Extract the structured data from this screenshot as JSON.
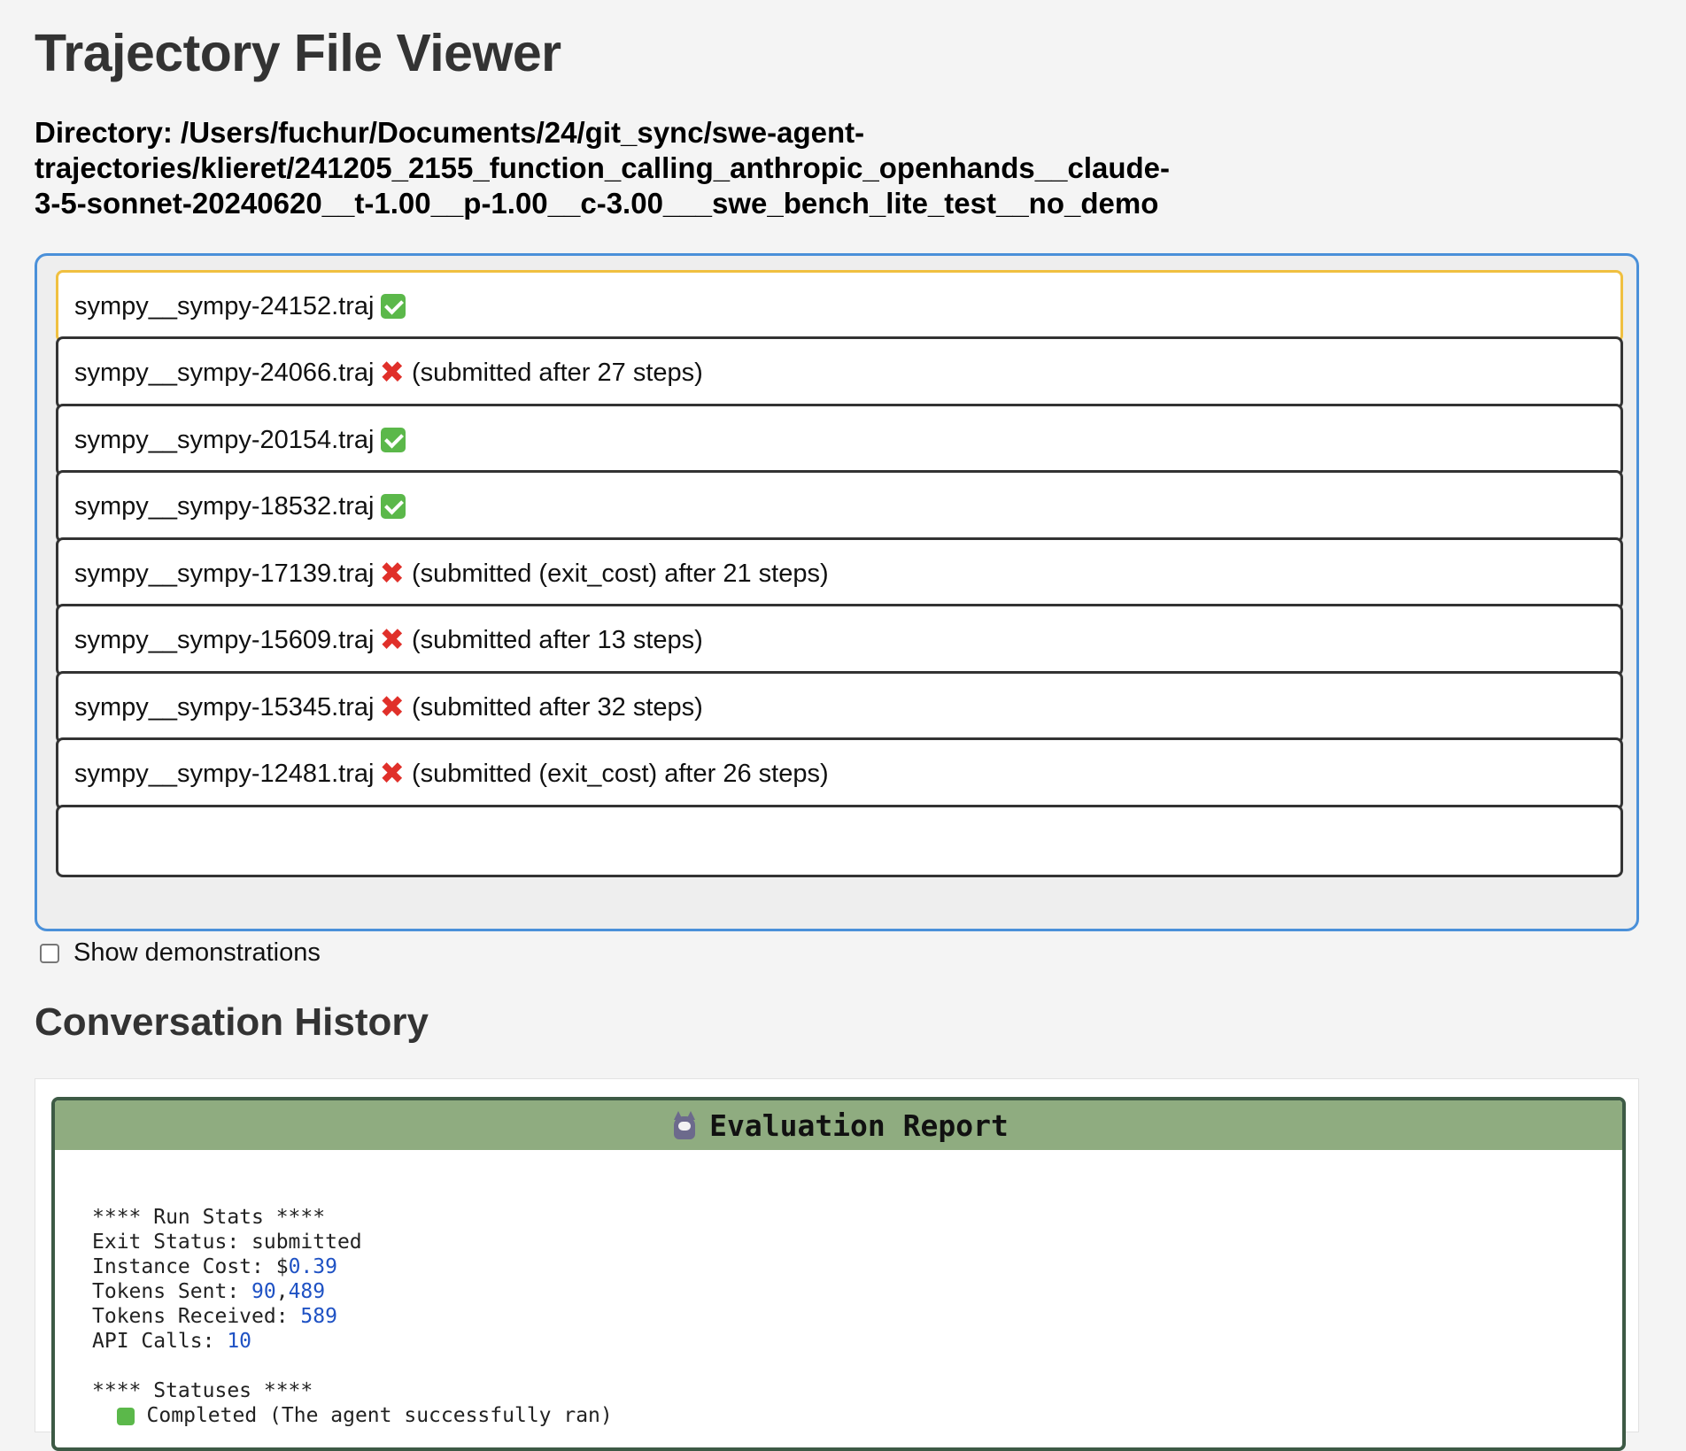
{
  "page": {
    "title": "Trajectory File Viewer",
    "directory_label": "Directory: /Users/fuchur/Documents/24/git_sync/swe-agent-trajectories/klieret/241205_2155_function_calling_anthropic_openhands__claude-3-5-sonnet-20240620__t-1.00__p-1.00__c-3.00___swe_bench_lite_test__no_demo"
  },
  "files": [
    {
      "name": "sympy__sympy-24152.traj",
      "status": "ok",
      "note": ""
    },
    {
      "name": "sympy__sympy-24066.traj",
      "status": "fail",
      "note": "(submitted after 27 steps)"
    },
    {
      "name": "sympy__sympy-20154.traj",
      "status": "ok",
      "note": ""
    },
    {
      "name": "sympy__sympy-18532.traj",
      "status": "ok",
      "note": ""
    },
    {
      "name": "sympy__sympy-17139.traj",
      "status": "fail",
      "note": "(submitted (exit_cost) after 21 steps)"
    },
    {
      "name": "sympy__sympy-15609.traj",
      "status": "fail",
      "note": "(submitted after 13 steps)"
    },
    {
      "name": "sympy__sympy-15345.traj",
      "status": "fail",
      "note": "(submitted after 32 steps)"
    },
    {
      "name": "sympy__sympy-12481.traj",
      "status": "fail",
      "note": "(submitted (exit_cost) after 26 steps)"
    },
    {
      "name": "",
      "status": "",
      "note": ""
    }
  ],
  "icons": {
    "ok": "check-mark-icon",
    "fail": "cross-mark-icon",
    "fail_glyph": "✖"
  },
  "demo_toggle": {
    "label": "Show demonstrations",
    "checked": false
  },
  "history": {
    "title": "Conversation History",
    "report": {
      "title": "Evaluation Report",
      "run_stats_header": "**** Run Stats ****",
      "exit_status_label": "Exit Status: ",
      "exit_status_value": "submitted",
      "instance_cost_label": "Instance Cost: $",
      "instance_cost_value": "0.39",
      "tokens_sent_label": "Tokens Sent: ",
      "tokens_sent_a": "90",
      "tokens_sent_sep": ",",
      "tokens_sent_b": "489",
      "tokens_received_label": "Tokens Received: ",
      "tokens_received_value": "589",
      "api_calls_label": "API Calls: ",
      "api_calls_value": "10",
      "statuses_header": "**** Statuses ****",
      "completed_line": " Completed (The agent successfully ran)"
    }
  },
  "colors": {
    "list_border": "#4a90d9",
    "selected_border": "#f0c040",
    "ok": "#5bb84a",
    "fail": "#e0302a",
    "report_header": "#8fac80",
    "number": "#1f52c4"
  }
}
